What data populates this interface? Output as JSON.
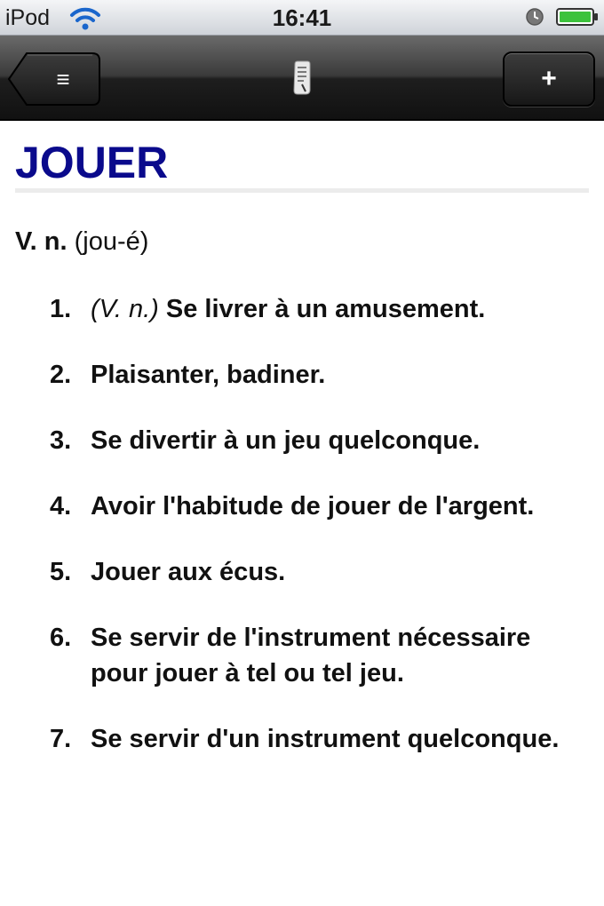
{
  "status_bar": {
    "device": "iPod",
    "time": "16:41",
    "icons": [
      "wifi-icon",
      "clock-icon",
      "battery-icon"
    ]
  },
  "nav_bar": {
    "back_label": "≡",
    "title_icon": "scroll-icon",
    "add_label": "+"
  },
  "entry": {
    "headword": "JOUER",
    "pos": "V. n.",
    "pronunciation": "(jou-é)",
    "definitions": [
      {
        "num": "1.",
        "tag": "(V. n.)",
        "text": "Se livrer à un amusement."
      },
      {
        "num": "2.",
        "tag": "",
        "text": "Plaisanter, badiner."
      },
      {
        "num": "3.",
        "tag": "",
        "text": "Se divertir à un jeu quelconque."
      },
      {
        "num": "4.",
        "tag": "",
        "text": "Avoir l'habitude de jouer de l'argent."
      },
      {
        "num": "5.",
        "tag": "",
        "text": "Jouer aux écus."
      },
      {
        "num": "6.",
        "tag": "",
        "text": "Se servir de l'instrument nécessaire pour jouer à tel ou tel jeu."
      },
      {
        "num": "7.",
        "tag": "",
        "text": "Se servir d'un instrument quelconque."
      }
    ]
  },
  "colors": {
    "headword": "#0a0a8c",
    "battery": "#3cc23c"
  }
}
